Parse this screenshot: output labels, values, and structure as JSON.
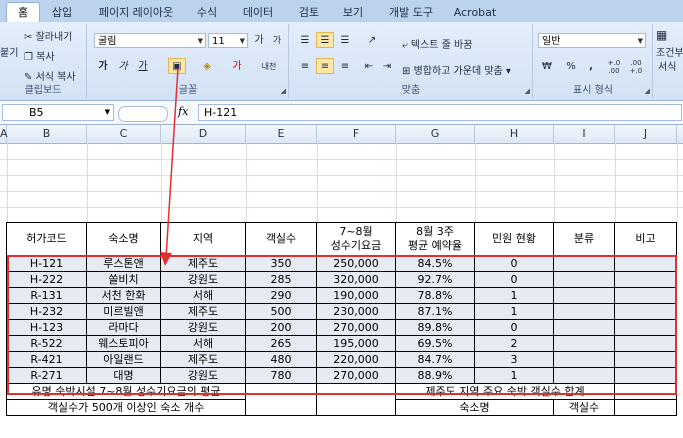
{
  "tabs": [
    "홈",
    "삽입",
    "페이지 레이아웃",
    "수식",
    "데이터",
    "검토",
    "보기",
    "개발 도구",
    "Acrobat"
  ],
  "clipboard": {
    "cut": "잘라내기",
    "copy": "복사",
    "format_painter": "서식 복사",
    "paste": "붙기",
    "label": "클립보드"
  },
  "font": {
    "name": "굴림",
    "size": "11",
    "label": "글꼴",
    "bold": "가",
    "italic": "가",
    "underline": "가",
    "grow": "가",
    "shrink": "가",
    "ko_fit": "내천"
  },
  "alignment": {
    "wrap": "텍스트 줄 바꿈",
    "merge": "병합하고 가운데 맞춤",
    "label": "맞춤"
  },
  "number": {
    "format": "일반",
    "currency": "₩",
    "percent": "%",
    "comma": ",",
    "inc": "+.0 .00",
    "dec": ".00 +.0",
    "label": "표시 형식"
  },
  "styles": {
    "cond1": "조건부",
    "cond2": "서식"
  },
  "formula_bar": {
    "cell": "B5",
    "fx": "fx",
    "value": "H-121"
  },
  "columns": [
    "A",
    "B",
    "C",
    "D",
    "E",
    "F",
    "G",
    "H",
    "I",
    "J"
  ],
  "table": {
    "headers": [
      "허가코드",
      "숙소명",
      "지역",
      "객실수",
      "7~8월\n성수기요금",
      "8월 3주\n평균 예약율",
      "민원 현황",
      "분류",
      "비고"
    ],
    "rows": [
      [
        "H-121",
        "루스톤앤",
        "제주도",
        "350",
        "250,000",
        "84.5%",
        "0",
        "",
        ""
      ],
      [
        "H-222",
        "쏠비치",
        "강원도",
        "285",
        "320,000",
        "92.7%",
        "0",
        "",
        ""
      ],
      [
        "R-131",
        "서천 한화",
        "서해",
        "290",
        "190,000",
        "78.8%",
        "1",
        "",
        ""
      ],
      [
        "H-232",
        "미르빌앤",
        "제주도",
        "500",
        "230,000",
        "87.1%",
        "1",
        "",
        ""
      ],
      [
        "H-123",
        "라마다",
        "강원도",
        "200",
        "270,000",
        "89.8%",
        "0",
        "",
        ""
      ],
      [
        "R-522",
        "웨스토피아",
        "서해",
        "265",
        "195,000",
        "69.5%",
        "2",
        "",
        ""
      ],
      [
        "R-421",
        "아일랜드",
        "제주도",
        "480",
        "220,000",
        "84.7%",
        "3",
        "",
        ""
      ],
      [
        "R-271",
        "대명",
        "강원도",
        "780",
        "270,000",
        "88.9%",
        "1",
        "",
        ""
      ]
    ],
    "footer1_left": "유명 숙박시설 7~8월 성수기요금의 평균",
    "footer1_right": "제주도 지역 주요 숙박 객실수 합계",
    "footer2_left": "객실수가 500개 이상인 숙소 개수",
    "footer2_mid": "숙소명",
    "footer2_right": "객실수"
  },
  "colors": {
    "selection_border": "#e03030",
    "arrow": "#e03030",
    "row_fill": "#e6eaf2"
  }
}
